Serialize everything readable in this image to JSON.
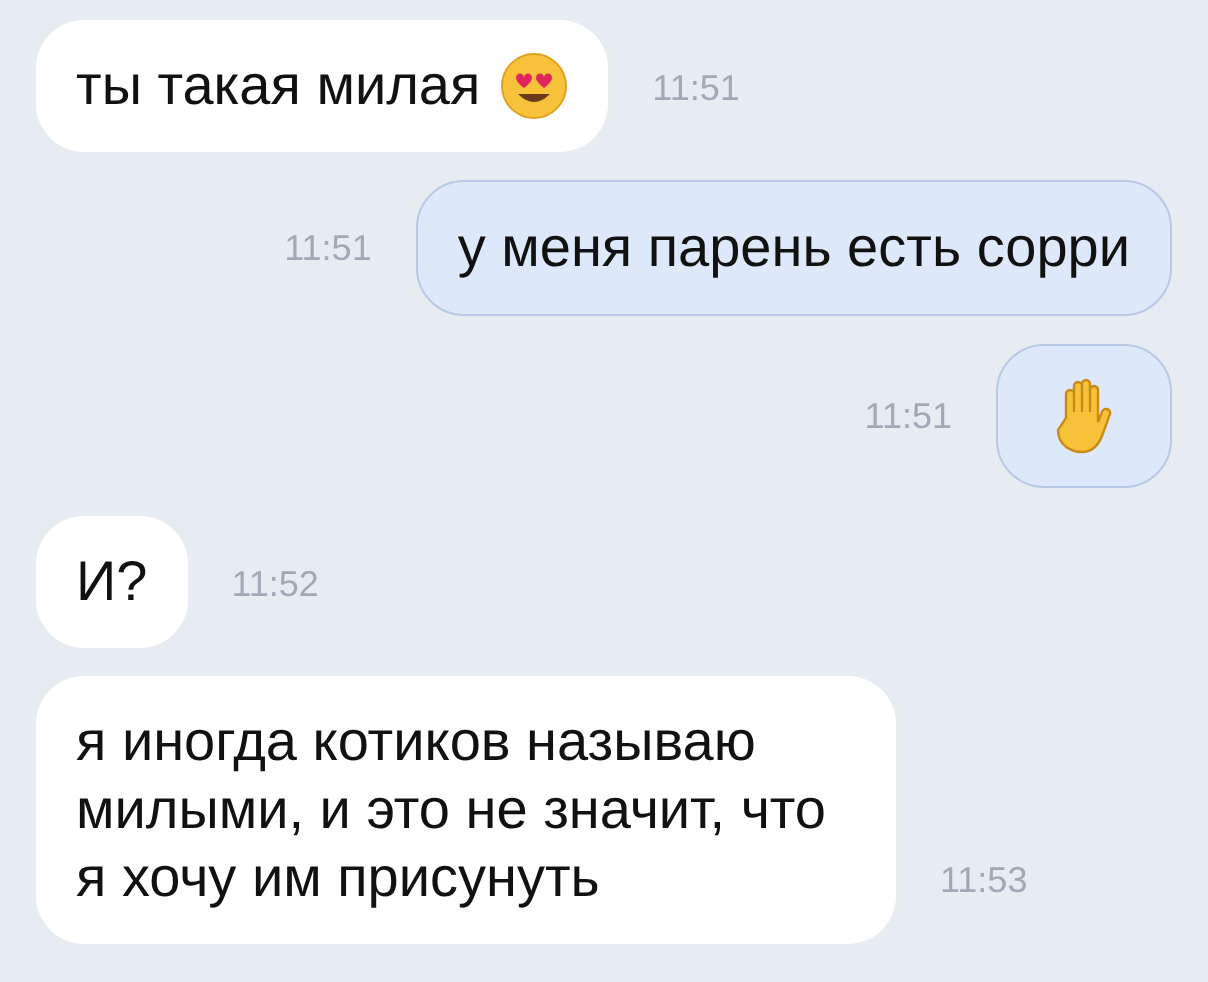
{
  "messages": [
    {
      "outgoing": false,
      "kind": "text_with_emoji",
      "text": "ты такая милая",
      "time": "11:51"
    },
    {
      "outgoing": true,
      "kind": "text",
      "text": "у меня парень есть сорри",
      "time": "11:51"
    },
    {
      "outgoing": true,
      "kind": "emoji",
      "time": "11:51"
    },
    {
      "outgoing": false,
      "kind": "text",
      "text": "И?",
      "time": "11:52"
    },
    {
      "outgoing": false,
      "kind": "text",
      "text": "я иногда котиков называю милыми, и это не значит, что я хочу им присунуть",
      "time": "11:53"
    }
  ]
}
